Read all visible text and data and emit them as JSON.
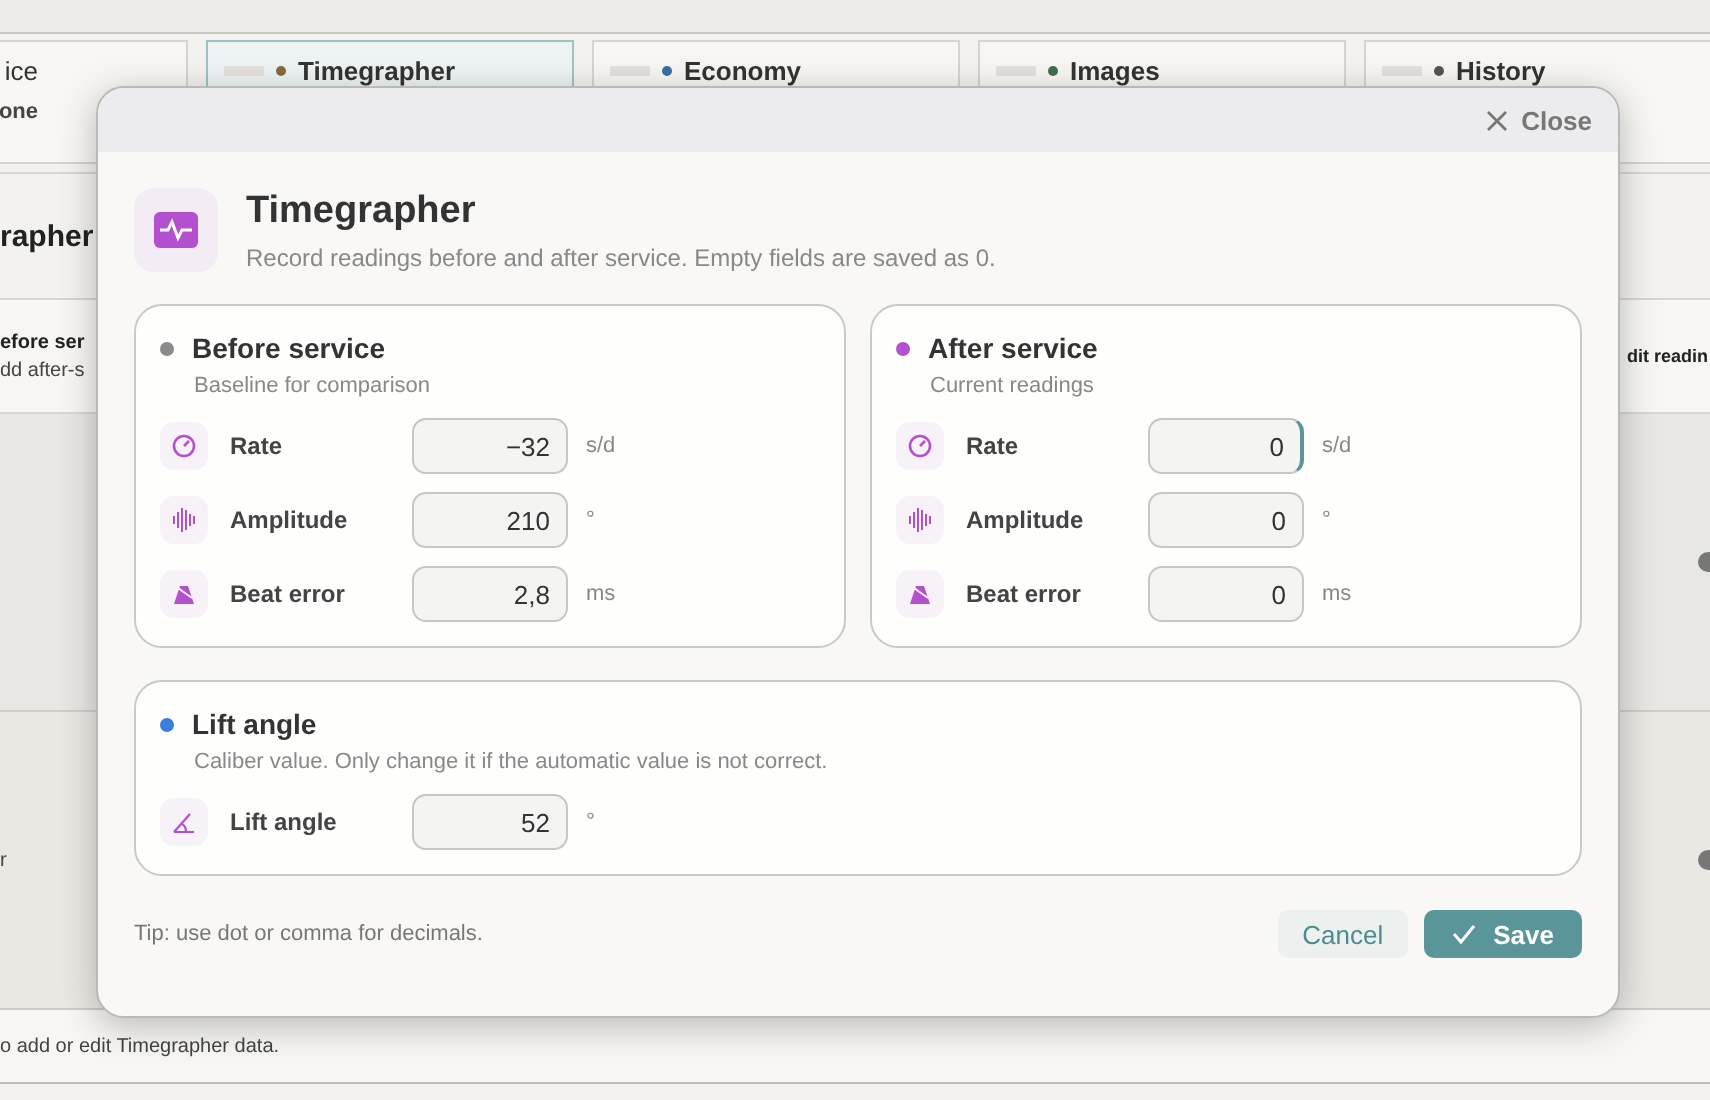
{
  "background": {
    "tabs": [
      {
        "label": "ice",
        "sublabel": "one",
        "selected": false
      },
      {
        "label": "Timegrapher",
        "selected": true,
        "color": "#8a6a3a"
      },
      {
        "label": "Economy",
        "selected": false,
        "color": "#3a6ea5"
      },
      {
        "label": "Images",
        "selected": false,
        "color": "#3f6f4f"
      },
      {
        "label": "History",
        "selected": false,
        "color": "#555555"
      }
    ],
    "section_title": "rapher",
    "card_title": "efore ser",
    "card_subtitle": "dd after-s",
    "edit_label": "dit readin",
    "side_text": "r",
    "footer_note": "o add or edit Timegrapher data."
  },
  "dialog": {
    "close_label": "Close",
    "title": "Timegrapher",
    "subtitle": "Record readings before and after service. Empty fields are saved as 0.",
    "sections": [
      {
        "title": "Before service",
        "subtitle": "Baseline for comparison",
        "color": "#8a8a8a",
        "wide": false,
        "rows": [
          {
            "kind": "rate",
            "label": "Rate",
            "value": "−32",
            "unit": "s/d",
            "focused": false
          },
          {
            "kind": "amplitude",
            "label": "Amplitude",
            "value": "210",
            "unit": "°",
            "focused": false
          },
          {
            "kind": "beat_error",
            "label": "Beat error",
            "value": "2,8",
            "unit": "ms",
            "focused": false
          }
        ]
      },
      {
        "title": "After service",
        "subtitle": "Current readings",
        "color": "#b44fd0",
        "wide": false,
        "rows": [
          {
            "kind": "rate",
            "label": "Rate",
            "value": "0",
            "unit": "s/d",
            "focused": true
          },
          {
            "kind": "amplitude",
            "label": "Amplitude",
            "value": "0",
            "unit": "°",
            "focused": false
          },
          {
            "kind": "beat_error",
            "label": "Beat error",
            "value": "0",
            "unit": "ms",
            "focused": false
          }
        ]
      },
      {
        "title": "Lift angle",
        "subtitle": "Caliber value. Only change it if the automatic value is not correct.",
        "color": "#3b7ddd",
        "wide": true,
        "rows": [
          {
            "kind": "lift_angle",
            "label": "Lift angle",
            "value": "52",
            "unit": "°",
            "focused": false
          }
        ]
      }
    ],
    "tip": "Tip: use dot or comma for decimals.",
    "cancel_label": "Cancel",
    "save_label": "Save"
  }
}
